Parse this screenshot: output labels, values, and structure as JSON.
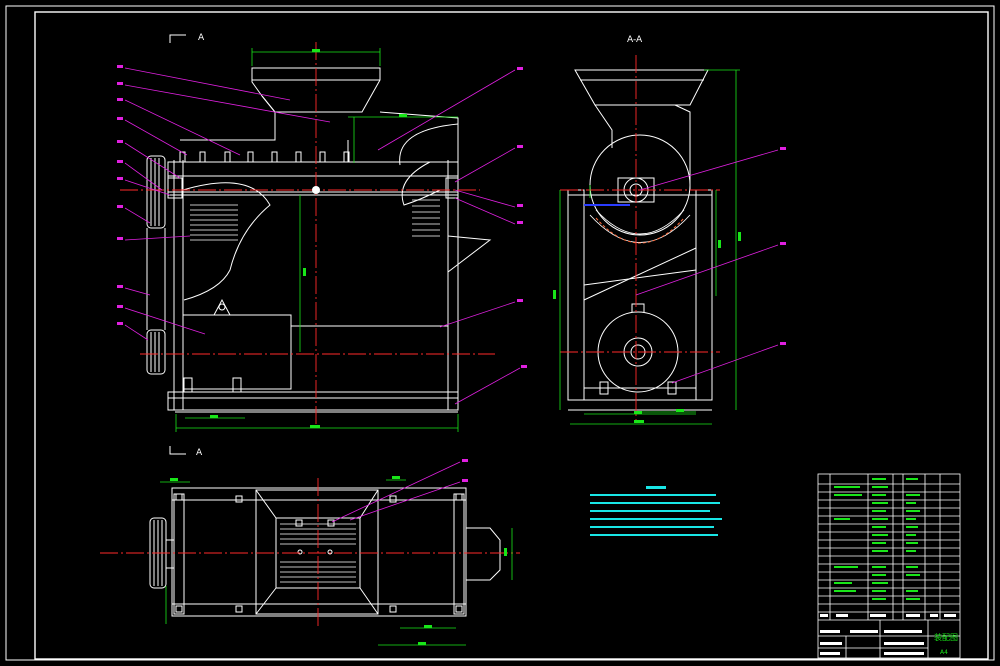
{
  "drawing": {
    "main_view_label": "A",
    "plan_view_label": "A",
    "section_title": "A-A",
    "background": "#000000",
    "colors": {
      "outline": "#ffffff",
      "centerline": "#ff2a2a",
      "dimension": "#19e619",
      "leader": "#e020e0",
      "notes": "#19e6e6",
      "accent_blue": "#2a3cff"
    }
  },
  "title_block": {
    "title_cell": "装配图",
    "scale": "A4"
  }
}
